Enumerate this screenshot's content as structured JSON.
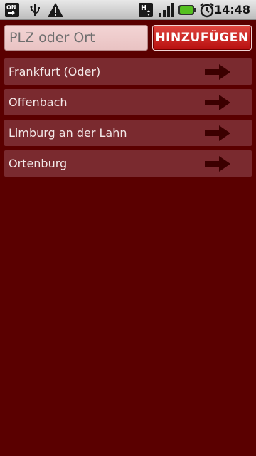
{
  "status_bar": {
    "time": "14:48",
    "left_icons": [
      "on-off-notification-icon",
      "usb-icon",
      "warning-icon"
    ],
    "right_icons": [
      "hsdpa-data-icon",
      "signal-strength-icon",
      "battery-icon",
      "alarm-clock-icon"
    ]
  },
  "search": {
    "placeholder": "PLZ oder Ort",
    "value": "",
    "add_button_label": "HINZUFÜGEN"
  },
  "locations": [
    {
      "name": "Frankfurt (Oder)"
    },
    {
      "name": "Offenbach"
    },
    {
      "name": "Limburg an der Lahn"
    },
    {
      "name": "Ortenburg"
    }
  ],
  "colors": {
    "background": "#5a0000",
    "list_item": "#7a2a2f",
    "arrow": "#3b0000",
    "button": "#c8201c"
  }
}
